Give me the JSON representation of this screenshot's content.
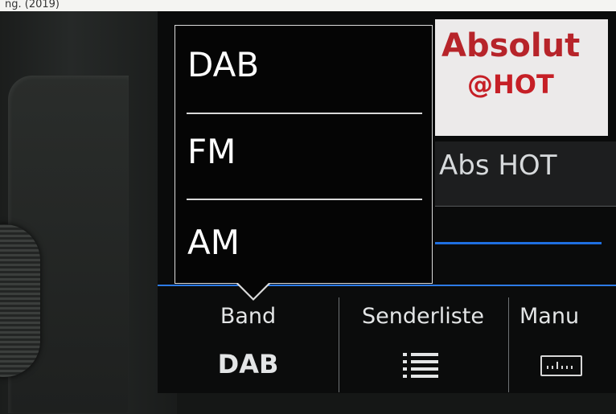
{
  "photo": {
    "top_caption": "ng. (2019)"
  },
  "station": {
    "logo_line1": "Absolut",
    "logo_line2": "@HOT",
    "name": "Abs HOT"
  },
  "band_popup": {
    "options": [
      "DAB",
      "FM",
      "AM"
    ]
  },
  "tabs": [
    {
      "label": "Band",
      "value": "DAB"
    },
    {
      "label": "Senderliste",
      "icon": "list-icon"
    },
    {
      "label": "Manu",
      "icon": "tuner-scale-icon"
    }
  ],
  "colors": {
    "accent": "#2d7be6",
    "logo_red": "#b7242a"
  }
}
